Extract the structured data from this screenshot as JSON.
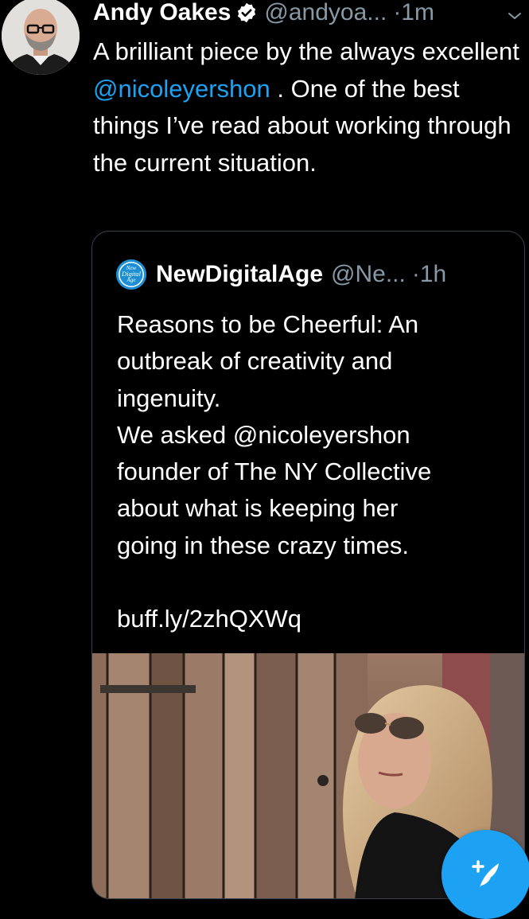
{
  "tweet": {
    "author_name": "Andy Oakes",
    "handle": "@andyoa...",
    "time": "·1m",
    "body_prefix": "A brilliant piece by the always excellent ",
    "mention": "@nicoleyershon",
    "body_suffix": " . One of the best things I’ve read about working through the current situation."
  },
  "quoted": {
    "logo_text": "New Digital Age",
    "name": "NewDigitalAge",
    "handle": "@Ne...",
    "time": "·1h",
    "lines": [
      "Reasons to be Cheerful: An",
      "outbreak of creativity and",
      "ingenuity.",
      "We asked @nicoleyershon",
      "founder of The NY Collective",
      "about what is keeping her",
      "going in these crazy times."
    ],
    "link": "buff.ly/2zhQXWq"
  },
  "icons": {
    "verified": "verified-badge-icon",
    "chevron": "chevron-down-icon",
    "compose": "compose-tweet-icon"
  },
  "colors": {
    "background": "#000000",
    "accent": "#1da1f2",
    "muted": "#8899a6",
    "border": "#38444d"
  }
}
